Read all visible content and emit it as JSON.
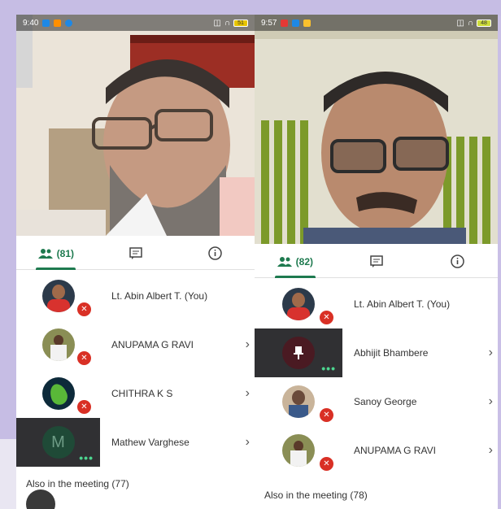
{
  "left": {
    "status": {
      "time": "9:40",
      "signal": "ᴺⁱⁱ",
      "battery": "51"
    },
    "tabs": {
      "people_count": "(81)"
    },
    "participants": [
      {
        "name": "Lt. Abin Albert T. (You)",
        "muted": true,
        "chevron": false
      },
      {
        "name": "ANUPAMA G RAVI",
        "muted": true,
        "chevron": true
      },
      {
        "name": "CHITHRA K S",
        "muted": true,
        "chevron": true
      },
      {
        "name": "Mathew Varghese",
        "initial": "M",
        "speaking": true,
        "chevron": true
      }
    ],
    "also": "Also in the meeting (77)"
  },
  "right": {
    "status": {
      "time": "9:57",
      "battery": "48"
    },
    "tabs": {
      "people_count": "(82)"
    },
    "participants": [
      {
        "name": "Lt. Abin Albert T. (You)",
        "muted": true,
        "chevron": false
      },
      {
        "name": "Abhijit Bhambere",
        "pinned": true,
        "speaking": true,
        "chevron": true
      },
      {
        "name": "Sanoy George",
        "muted": true,
        "chevron": true
      },
      {
        "name": "ANUPAMA G RAVI",
        "muted": true,
        "chevron": true
      }
    ],
    "also": "Also in the meeting (78)"
  },
  "colors": {
    "accent": "#1e7a4f",
    "muted_red": "#d93025",
    "speaking_green": "#4cd690"
  },
  "icons": {
    "people": "people-icon",
    "chat": "chat-icon",
    "info": "info-icon",
    "mic_off": "mic-off-icon",
    "pin": "pin-icon",
    "chevron": "chevron-right-icon"
  }
}
